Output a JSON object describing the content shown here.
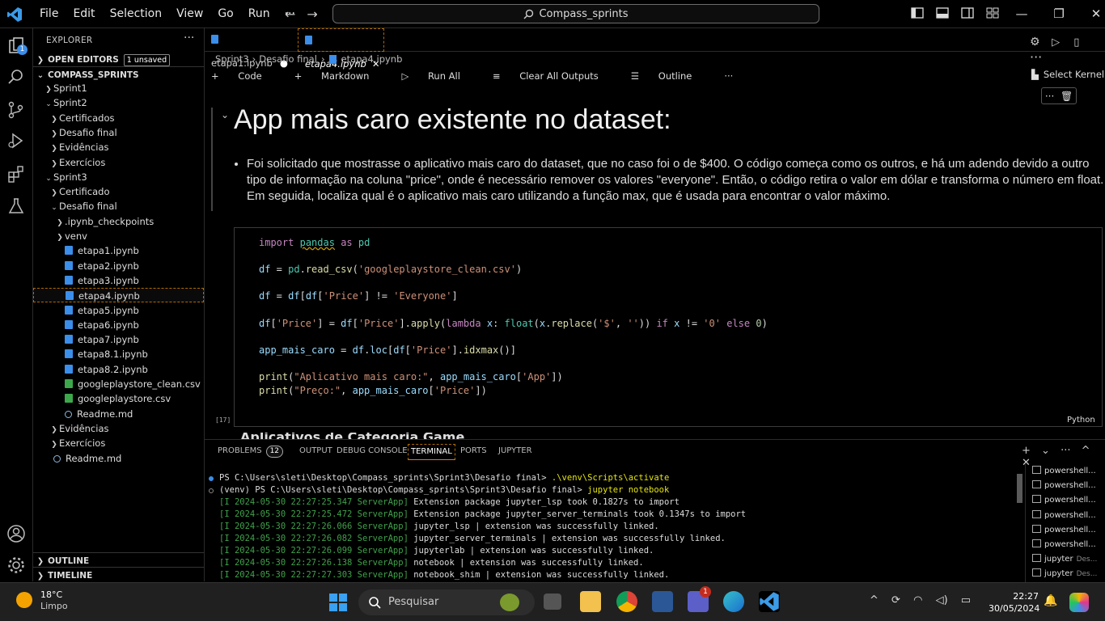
{
  "titlebar": {
    "menu": [
      "File",
      "Edit",
      "Selection",
      "View",
      "Go",
      "Run",
      "···"
    ],
    "search": "Compass_sprints",
    "window_controls": [
      "—",
      "❐",
      "✕"
    ]
  },
  "activity": {
    "source_control_badge": "1"
  },
  "sidebar": {
    "title": "EXPLORER",
    "more": "···",
    "open_editors": {
      "label": "OPEN EDITORS",
      "badge": "1 unsaved"
    },
    "workspace": "COMPASS_SPRINTS",
    "tree": [
      {
        "label": "Sprint1",
        "type": "folder",
        "depth": 1,
        "open": false
      },
      {
        "label": "Sprint2",
        "type": "folder",
        "depth": 1,
        "open": true
      },
      {
        "label": "Certificados",
        "type": "folder",
        "depth": 2,
        "open": false
      },
      {
        "label": "Desafio final",
        "type": "folder",
        "depth": 2,
        "open": false
      },
      {
        "label": "Evidências",
        "type": "folder",
        "depth": 2,
        "open": false
      },
      {
        "label": "Exercícios",
        "type": "folder",
        "depth": 2,
        "open": false
      },
      {
        "label": "Sprint3",
        "type": "folder",
        "depth": 1,
        "open": true
      },
      {
        "label": "Certificado",
        "type": "folder",
        "depth": 2,
        "open": false
      },
      {
        "label": "Desafio final",
        "type": "folder",
        "depth": 2,
        "open": true
      },
      {
        "label": ".ipynb_checkpoints",
        "type": "folder",
        "depth": 3,
        "open": false
      },
      {
        "label": "venv",
        "type": "folder",
        "depth": 3,
        "open": false
      },
      {
        "label": "etapa1.ipynb",
        "type": "nb",
        "depth": 3
      },
      {
        "label": "etapa2.ipynb",
        "type": "nb",
        "depth": 3
      },
      {
        "label": "etapa3.ipynb",
        "type": "nb",
        "depth": 3
      },
      {
        "label": "etapa4.ipynb",
        "type": "nb",
        "depth": 3,
        "selected": true
      },
      {
        "label": "etapa5.ipynb",
        "type": "nb",
        "depth": 3
      },
      {
        "label": "etapa6.ipynb",
        "type": "nb",
        "depth": 3
      },
      {
        "label": "etapa7.ipynb",
        "type": "nb",
        "depth": 3
      },
      {
        "label": "etapa8.1.ipynb",
        "type": "nb",
        "depth": 3
      },
      {
        "label": "etapa8.2.ipynb",
        "type": "nb",
        "depth": 3
      },
      {
        "label": "googleplaystore_clean.csv",
        "type": "csv",
        "depth": 3
      },
      {
        "label": "googleplaystore.csv",
        "type": "csv",
        "depth": 3
      },
      {
        "label": "Readme.md",
        "type": "md",
        "depth": 3
      },
      {
        "label": "Evidências",
        "type": "folder",
        "depth": 2,
        "open": false
      },
      {
        "label": "Exercícios",
        "type": "folder",
        "depth": 2,
        "open": false
      },
      {
        "label": "Readme.md",
        "type": "md",
        "depth": 1
      }
    ],
    "outline": "OUTLINE",
    "timeline": "TIMELINE"
  },
  "editor": {
    "tabs": [
      {
        "label": "etapa1.ipynb",
        "marker": "●"
      },
      {
        "label": "etapa4.ipynb",
        "marker": "✕"
      }
    ],
    "breadcrumb": [
      "Sprint3",
      "Desafio final",
      "etapa4.ipynb"
    ],
    "toolbar": {
      "code": "Code",
      "markdown": "Markdown",
      "run_all": "Run All",
      "clear": "Clear All Outputs",
      "outline": "Outline",
      "more": "···"
    },
    "kernel": "Select Kernel",
    "heading": "App mais caro existente no dataset:",
    "bullet": "Foi solicitado que mostrasse o aplicativo mais caro do dataset, que no caso foi o de $400. O código começa como os outros, e há um adendo devido a outro tipo de informação na coluna \"price\", onde é necessário remover os valores \"everyone\". Então, o código retira o valor em dólar e transforma o número em float. Em seguida, localiza qual é o aplicativo mais caro utilizando a função max, que é usada para encontrar o valor máximo.",
    "exec_count": "[17]",
    "language": "Python",
    "next_cell_peek": "Aplicativos de Categoria Game Edition"
  },
  "panel": {
    "tabs": [
      {
        "label": "PROBLEMS",
        "badge": "12"
      },
      {
        "label": "OUTPUT"
      },
      {
        "label": "DEBUG CONSOLE"
      },
      {
        "label": "TERMINAL",
        "active": true
      },
      {
        "label": "PORTS"
      },
      {
        "label": "JUPYTER"
      }
    ],
    "actions": [
      "+",
      "⌄",
      "···",
      "^",
      "✕"
    ],
    "terminal": [
      {
        "prefix": "PS C:\\Users\\sleti\\Desktop\\Compass_sprints\\Sprint3\\Desafio final> ",
        "cmd": ".\\venv\\Scripts\\activate",
        "dot": "#3b8eea"
      },
      {
        "prefix": "(venv) PS C:\\Users\\sleti\\Desktop\\Compass_sprints\\Sprint3\\Desafio final> ",
        "cmd": "jupyter notebook",
        "dot": "#888"
      },
      {
        "log": "[I 2024-05-30 22:27:25.347 ServerApp]",
        "msg": " Extension package jupyter_lsp took 0.1827s to import"
      },
      {
        "log": "[I 2024-05-30 22:27:25.472 ServerApp]",
        "msg": " Extension package jupyter_server_terminals took 0.1347s to import"
      },
      {
        "log": "[I 2024-05-30 22:27:26.066 ServerApp]",
        "msg": " jupyter_lsp | extension was successfully linked."
      },
      {
        "log": "[I 2024-05-30 22:27:26.082 ServerApp]",
        "msg": " jupyter_server_terminals | extension was successfully linked."
      },
      {
        "log": "[I 2024-05-30 22:27:26.099 ServerApp]",
        "msg": " jupyterlab | extension was successfully linked."
      },
      {
        "log": "[I 2024-05-30 22:27:26.138 ServerApp]",
        "msg": " notebook | extension was successfully linked."
      },
      {
        "log": "[I 2024-05-30 22:27:27.303 ServerApp]",
        "msg": " notebook_shim | extension was successfully linked."
      }
    ],
    "terminal_list": [
      {
        "label": "powershell...",
        "desc": ""
      },
      {
        "label": "powershell...",
        "desc": ""
      },
      {
        "label": "powershell...",
        "desc": ""
      },
      {
        "label": "powershell...",
        "desc": ""
      },
      {
        "label": "powershell...",
        "desc": ""
      },
      {
        "label": "powershell...",
        "desc": ""
      },
      {
        "label": "jupyter",
        "desc": "Des..."
      },
      {
        "label": "jupyter",
        "desc": "Des..."
      }
    ]
  },
  "taskbar": {
    "temp": "18°C",
    "condition": "Limpo",
    "search": "Pesquisar",
    "time": "22:27",
    "date": "30/05/2024",
    "teams_badge": "1"
  }
}
